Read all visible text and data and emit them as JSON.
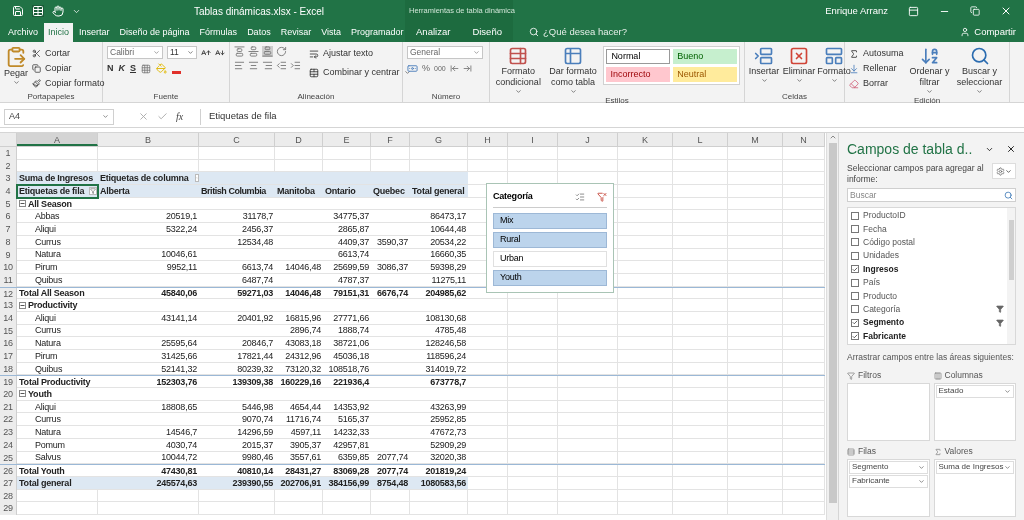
{
  "title_bar": {
    "title": "Tablas dinámicas.xlsx  -  Excel",
    "user": "Enrique Arranz"
  },
  "tabs": [
    {
      "label": "Archivo",
      "selected": false
    },
    {
      "label": "Inicio",
      "selected": true
    },
    {
      "label": "Insertar",
      "selected": false
    },
    {
      "label": "Diseño de página",
      "selected": false
    },
    {
      "label": "Fórmulas",
      "selected": false
    },
    {
      "label": "Datos",
      "selected": false
    },
    {
      "label": "Revisar",
      "selected": false
    },
    {
      "label": "Vista",
      "selected": false
    },
    {
      "label": "Programador",
      "selected": false
    }
  ],
  "contextual_group": {
    "title": "Herramientas de tabla dinámica",
    "tabs": [
      {
        "label": "Analizar",
        "selected": false
      },
      {
        "label": "Diseño",
        "selected": false
      }
    ]
  },
  "tell_me": {
    "placeholder": "¿Qué desea hacer?"
  },
  "share": "Compartir",
  "ribbon": {
    "groups": [
      {
        "kind": "clipboard",
        "label": "Portapapeles",
        "paste": "Pegar",
        "items": [
          "Cortar",
          "Copiar",
          "Copiar formato"
        ]
      },
      {
        "kind": "font",
        "label": "Fuente",
        "font": "Calibri",
        "size": "11",
        "styles": [
          "N",
          "K",
          "S"
        ]
      },
      {
        "kind": "alignment",
        "label": "Alineación",
        "items": [
          "Ajustar texto",
          "Combinar y centrar"
        ]
      },
      {
        "kind": "number",
        "label": "Número",
        "format": "General",
        "symbols": [
          "%",
          "000"
        ]
      },
      {
        "kind": "styles",
        "label": "Estilos",
        "buttons": [
          "Formato condicional",
          "Dar formato como tabla"
        ],
        "cell_styles": [
          {
            "label": "Normal",
            "color": "#ffffff"
          },
          {
            "label": "Bueno",
            "color": "#c6efce"
          },
          {
            "label": "Incorrecto",
            "color": "#ffc7ce"
          },
          {
            "label": "Neutral",
            "color": "#ffeb9c"
          }
        ]
      },
      {
        "kind": "cells",
        "label": "Celdas",
        "buttons": [
          "Insertar",
          "Eliminar",
          "Formato"
        ]
      },
      {
        "kind": "editing",
        "label": "Edición",
        "items": [
          "Autosuma",
          "Rellenar",
          "Borrar"
        ],
        "buttons": [
          "Ordenar y filtrar",
          "Buscar y seleccionar"
        ]
      }
    ]
  },
  "formula_bar": {
    "name_box": "A4",
    "fx": "fx",
    "formula": "Etiquetas de fila"
  },
  "sheet": {
    "columns": [
      "A",
      "B",
      "C",
      "D",
      "E",
      "F",
      "G",
      "H",
      "I",
      "J",
      "K",
      "L",
      "M",
      "N"
    ],
    "rows": [
      {
        "row": "1",
        "kind": "blank"
      },
      {
        "row": "2",
        "kind": "blank"
      },
      {
        "row": "3",
        "kind": "header",
        "cells": {
          "A": "Suma de Ingresos",
          "B": "Etiquetas de columna"
        }
      },
      {
        "row": "4",
        "kind": "labels",
        "active": true,
        "cells": {
          "A": "Etiquetas de fila",
          "B": "Alberta",
          "C": "British Columbia",
          "D": "Manitoba",
          "E": "Ontario",
          "F": "Quebec",
          "G": "Total general"
        }
      },
      {
        "row": "5",
        "kind": "group",
        "cells": {
          "A": "All Season"
        }
      },
      {
        "row": "6",
        "kind": "item",
        "cells": {
          "A": "Abbas",
          "B": "20519,1",
          "C": "31178,7",
          "E": "34775,37",
          "G": "86473,17"
        }
      },
      {
        "row": "7",
        "kind": "item",
        "cells": {
          "A": "Aliqui",
          "B": "5322,24",
          "C": "2456,37",
          "E": "2865,87",
          "G": "10644,48"
        }
      },
      {
        "row": "8",
        "kind": "item",
        "cells": {
          "A": "Currus",
          "C": "12534,48",
          "E": "4409,37",
          "F": "3590,37",
          "G": "20534,22"
        }
      },
      {
        "row": "9",
        "kind": "item",
        "cells": {
          "A": "Natura",
          "B": "10046,61",
          "E": "6613,74",
          "G": "16660,35"
        }
      },
      {
        "row": "10",
        "kind": "item",
        "cells": {
          "A": "Pirum",
          "B": "9952,11",
          "C": "6613,74",
          "D": "14046,48",
          "E": "25699,59",
          "F": "3086,37",
          "G": "59398,29"
        }
      },
      {
        "row": "11",
        "kind": "item",
        "cells": {
          "A": "Quibus",
          "C": "6487,74",
          "E": "4787,37",
          "G": "11275,11"
        }
      },
      {
        "row": "12",
        "kind": "subtotal",
        "cells": {
          "A": "Total All Season",
          "B": "45840,06",
          "C": "59271,03",
          "D": "14046,48",
          "E": "79151,31",
          "F": "6676,74",
          "G": "204985,62"
        }
      },
      {
        "row": "13",
        "kind": "group",
        "cells": {
          "A": "Productivity"
        }
      },
      {
        "row": "14",
        "kind": "item",
        "cells": {
          "A": "Aliqui",
          "B": "43141,14",
          "C": "20401,92",
          "D": "16815,96",
          "E": "27771,66",
          "G": "108130,68"
        }
      },
      {
        "row": "15",
        "kind": "item",
        "cells": {
          "A": "Currus",
          "D": "2896,74",
          "E": "1888,74",
          "G": "4785,48"
        }
      },
      {
        "row": "16",
        "kind": "item",
        "cells": {
          "A": "Natura",
          "B": "25595,64",
          "C": "20846,7",
          "D": "43083,18",
          "E": "38721,06",
          "G": "128246,58"
        }
      },
      {
        "row": "17",
        "kind": "item",
        "cells": {
          "A": "Pirum",
          "B": "31425,66",
          "C": "17821,44",
          "D": "24312,96",
          "E": "45036,18",
          "G": "118596,24"
        }
      },
      {
        "row": "18",
        "kind": "item",
        "cells": {
          "A": "Quibus",
          "B": "52141,32",
          "C": "80239,32",
          "D": "73120,32",
          "E": "108518,76",
          "G": "314019,72"
        }
      },
      {
        "row": "19",
        "kind": "subtotal",
        "cells": {
          "A": "Total Productivity",
          "B": "152303,76",
          "C": "139309,38",
          "D": "160229,16",
          "E": "221936,4",
          "G": "673778,7"
        }
      },
      {
        "row": "20",
        "kind": "group",
        "cells": {
          "A": "Youth"
        }
      },
      {
        "row": "21",
        "kind": "item",
        "cells": {
          "A": "Aliqui",
          "B": "18808,65",
          "C": "5446,98",
          "D": "4654,44",
          "E": "14353,92",
          "G": "43263,99"
        }
      },
      {
        "row": "22",
        "kind": "item",
        "cells": {
          "A": "Currus",
          "C": "9070,74",
          "D": "11716,74",
          "E": "5165,37",
          "G": "25952,85"
        }
      },
      {
        "row": "23",
        "kind": "item",
        "cells": {
          "A": "Natura",
          "B": "14546,7",
          "C": "14296,59",
          "D": "4597,11",
          "E": "14232,33",
          "G": "47672,73"
        }
      },
      {
        "row": "24",
        "kind": "item",
        "cells": {
          "A": "Pomum",
          "B": "4030,74",
          "C": "2015,37",
          "D": "3905,37",
          "E": "42957,81",
          "G": "52909,29"
        }
      },
      {
        "row": "25",
        "kind": "item",
        "cells": {
          "A": "Salvus",
          "B": "10044,72",
          "C": "9980,46",
          "D": "3557,61",
          "E": "6359,85",
          "F": "2077,74",
          "G": "32020,38"
        }
      },
      {
        "row": "26",
        "kind": "subtotal",
        "cells": {
          "A": "Total Youth",
          "B": "47430,81",
          "C": "40810,14",
          "D": "28431,27",
          "E": "83069,28",
          "F": "2077,74",
          "G": "201819,24"
        }
      },
      {
        "row": "27",
        "kind": "grand",
        "cells": {
          "A": "Total general",
          "B": "245574,63",
          "C": "239390,55",
          "D": "202706,91",
          "E": "384156,99",
          "F": "8754,48",
          "G": "1080583,56"
        }
      },
      {
        "row": "28",
        "kind": "blank"
      },
      {
        "row": "29",
        "kind": "blank"
      }
    ]
  },
  "slicer": {
    "title": "Categoría",
    "items": [
      {
        "label": "Mix",
        "selected": true
      },
      {
        "label": "Rural",
        "selected": true
      },
      {
        "label": "Urban",
        "selected": false
      },
      {
        "label": "Youth",
        "selected": true
      }
    ]
  },
  "field_pane": {
    "title": "Campos de tabla d..",
    "subtitle": "Seleccionar campos para agregar al informe:",
    "search": {
      "placeholder": "Buscar"
    },
    "fields": [
      {
        "label": "ProductoID",
        "checked": false,
        "filtered": false
      },
      {
        "label": "Fecha",
        "checked": false,
        "filtered": false
      },
      {
        "label": "Código postal",
        "checked": false,
        "filtered": false
      },
      {
        "label": "Unidades",
        "checked": false,
        "filtered": false
      },
      {
        "label": "Ingresos",
        "checked": true,
        "filtered": false
      },
      {
        "label": "País",
        "checked": false,
        "filtered": false
      },
      {
        "label": "Producto",
        "checked": false,
        "filtered": false
      },
      {
        "label": "Categoría",
        "checked": false,
        "filtered": true
      },
      {
        "label": "Segmento",
        "checked": true,
        "filtered": true
      },
      {
        "label": "Fabricante",
        "checked": true,
        "filtered": false
      }
    ],
    "areas_hint": "Arrastrar campos entre las áreas siguientes:",
    "areas": [
      {
        "kind": "filters",
        "title": "Filtros"
      },
      {
        "kind": "columns",
        "title": "Columnas",
        "items": [
          "Estado"
        ]
      },
      {
        "kind": "rows",
        "title": "Filas",
        "items": [
          "Segmento",
          "Fabricante"
        ]
      },
      {
        "kind": "values",
        "title": "Valores",
        "items": [
          "Suma de Ingresos"
        ]
      }
    ]
  }
}
